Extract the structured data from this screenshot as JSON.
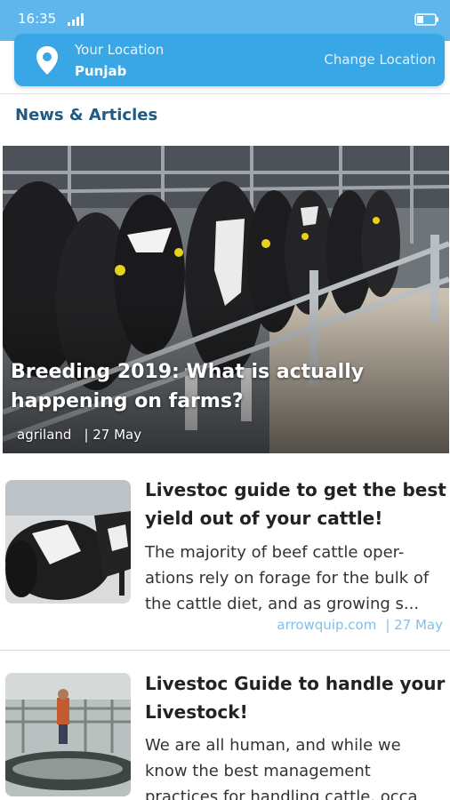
{
  "status_bar": {
    "time": "16:35"
  },
  "location": {
    "label": "Your Location",
    "value": "Punjab",
    "change_label": "Change Location"
  },
  "section": {
    "title": "News & Articles"
  },
  "featured": {
    "title": "Breeding 2019: What is actually happening on farms?",
    "source": "agriland",
    "date": "| 27 May"
  },
  "articles": [
    {
      "title": "Livestoc guide to get the best yield out of your cattle!",
      "excerpt": "The majority of beef cattle oper- ations rely on forage for the bulk of the cattle diet, and as growing s...",
      "source": "arrowquip.com",
      "date": "| 27 May"
    },
    {
      "title": "Livestoc Guide to handle your Livestock!",
      "excerpt": "We are all human, and while we know the best management practices for handling cattle, occa"
    }
  ],
  "colors": {
    "status_bar": "#5fb6ec",
    "location_bar": "#39a6e6",
    "section_title": "#1f5a84",
    "meta_link": "#7fc1ea"
  },
  "icons": {
    "location": "map-pin-icon",
    "signal": "signal-icon",
    "battery": "battery-icon"
  }
}
